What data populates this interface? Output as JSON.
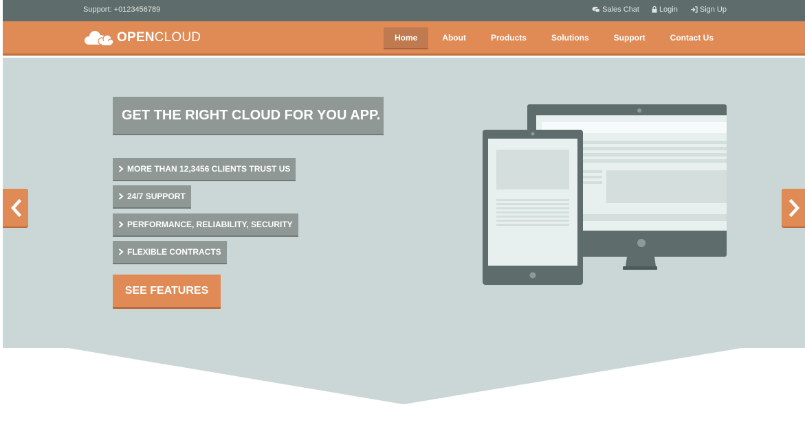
{
  "topbar": {
    "support": "Support: +0123456789",
    "links": [
      {
        "label": "Sales Chat",
        "icon": "chat-icon"
      },
      {
        "label": "Login",
        "icon": "lock-icon"
      },
      {
        "label": "Sign Up",
        "icon": "sign-in-icon"
      }
    ]
  },
  "navbar": {
    "logo_bold": "OPEN",
    "logo_light": "CLOUD",
    "items": [
      "Home",
      "About",
      "Products",
      "Solutions",
      "Support",
      "Contact Us"
    ],
    "active": "Home"
  },
  "hero": {
    "headline": "GET THE RIGHT CLOUD FOR YOU APP.",
    "features": [
      "MORE THAN 12,3456 CLIENTS TRUST US",
      "24/7 SUPPORT",
      "PERFORMANCE, RELIABILITY, SECURITY",
      "FLEXIBLE CONTRACTS"
    ],
    "cta": "SEE FEATURES"
  },
  "colors": {
    "topbar": "#5e6d6b",
    "accent": "#e08a55",
    "hero_bg": "#cad7d6",
    "label_bg": "#8f9895",
    "device": "#5e6d6b"
  }
}
